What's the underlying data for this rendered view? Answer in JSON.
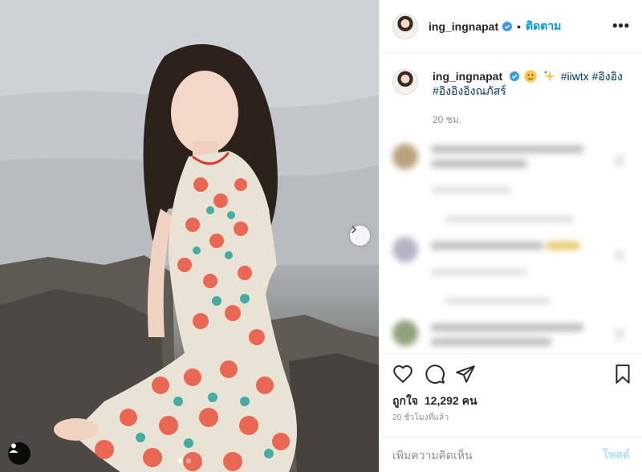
{
  "post": {
    "username": "ing_ingnapat",
    "verified_icon": "verified-badge-icon",
    "follow_label": "ติดตาม",
    "more_label": "•••",
    "caption": {
      "hashtags": [
        "#iiwtx",
        "#อิงอิง",
        "#อิงอิงอิงณภัสร์"
      ],
      "emojis": [
        "smiling-face-emoji",
        "sparkle-emoji"
      ]
    },
    "caption_time": "20 ชม.",
    "likes_prefix": "ถูกใจ",
    "likes_count": "12,292",
    "likes_suffix": "คน",
    "post_time": "20 ชั่วโมงที่แล้ว",
    "comment_placeholder": "เพิ่มความคิดเห็น",
    "post_label": "โพสต์"
  },
  "carousel": {
    "dot_count": 2,
    "active_index": 0
  },
  "colors": {
    "accent": "#0095f6",
    "post_disabled": "#b2dffc",
    "hashtag": "#00376b",
    "muted": "#8e8e8e"
  }
}
